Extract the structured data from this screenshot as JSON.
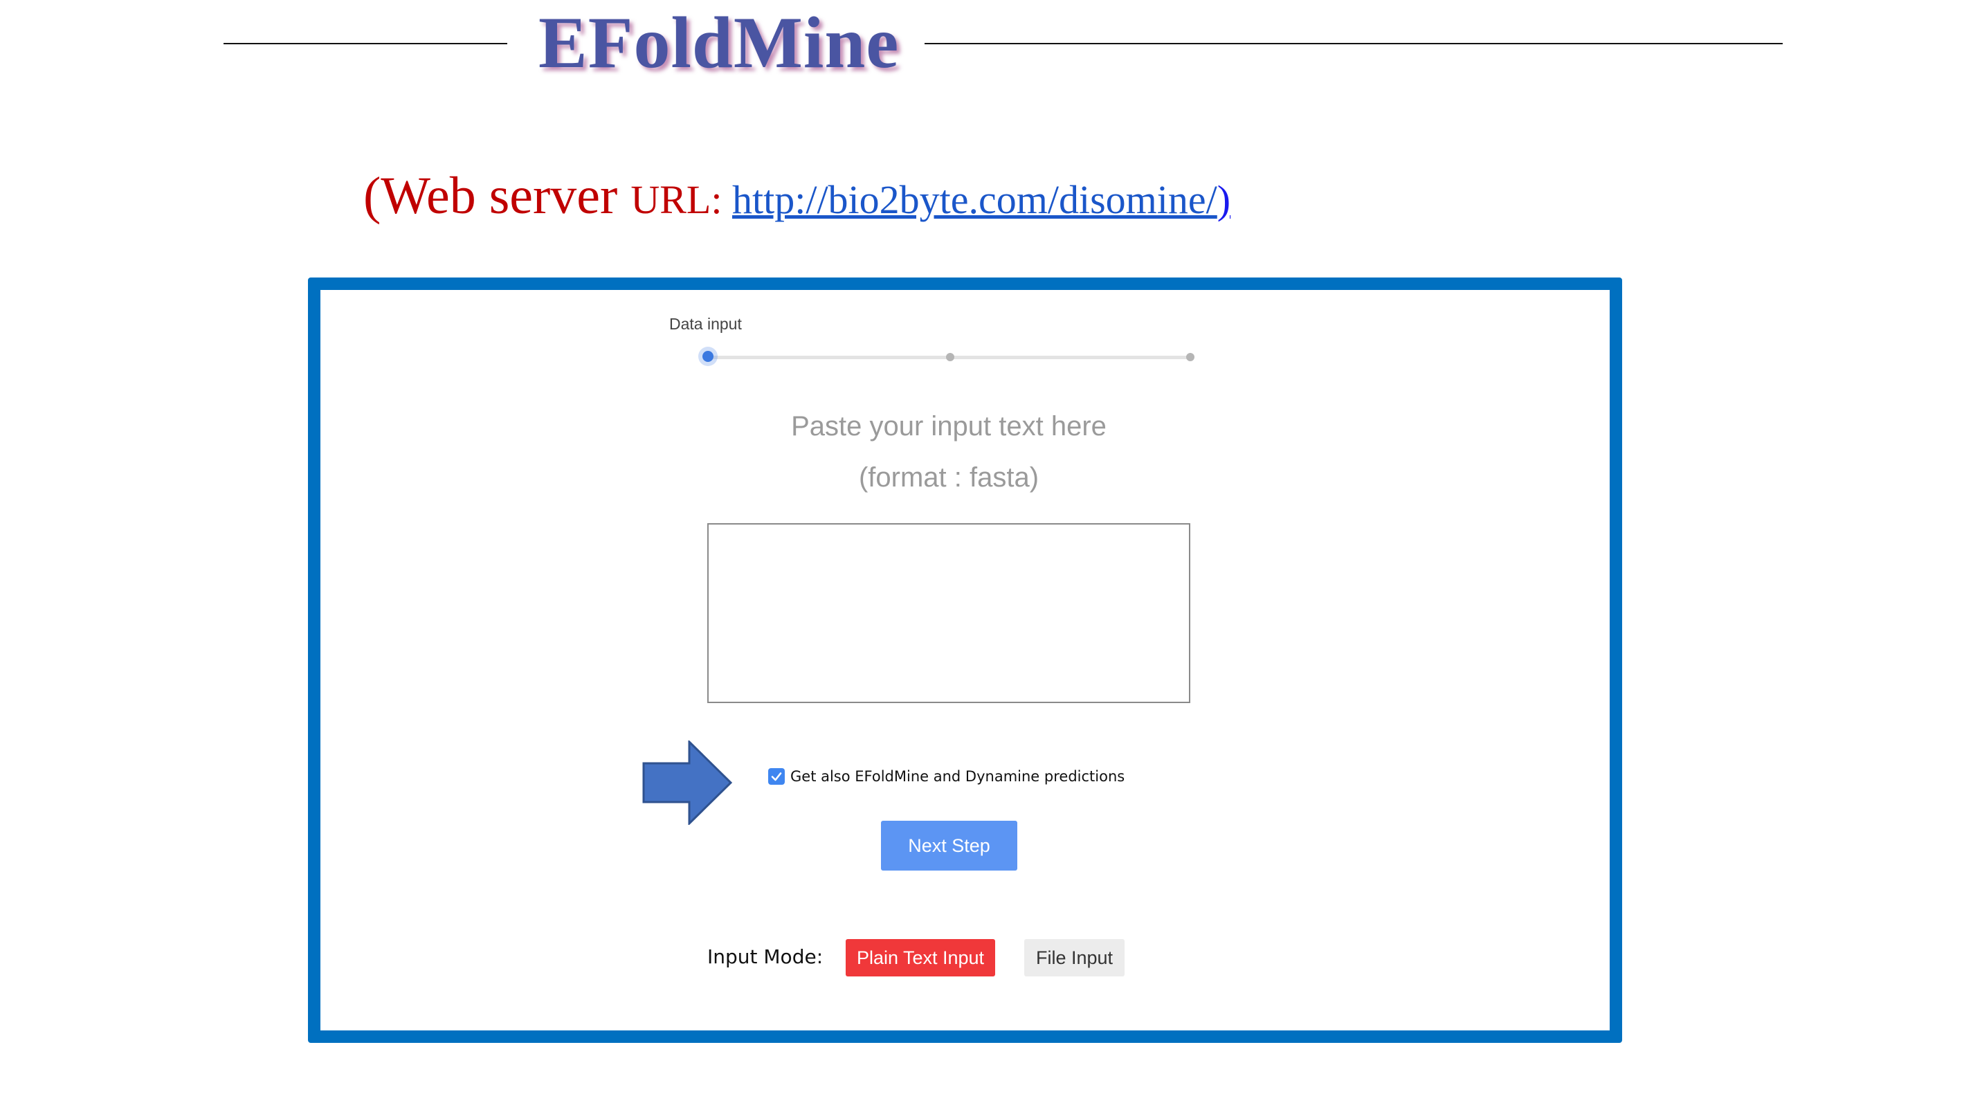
{
  "header": {
    "title": "EFoldMine"
  },
  "server_line": {
    "prefix_big": "(Web server ",
    "prefix_small": "URL: ",
    "link_text": "http://bio2byte.com/disomine/",
    "suffix": ")"
  },
  "form": {
    "stepper": {
      "current_label": "Data input",
      "total_steps": 3,
      "active_step": 1
    },
    "paste_heading": "Paste your input text here",
    "paste_format": "(format : fasta)",
    "sequence_value": "",
    "checkbox": {
      "label": "Get also EFoldMine and Dynamine predictions",
      "checked": true
    },
    "next_button": "Next Step",
    "input_mode": {
      "label": "Input Mode:",
      "options": [
        "Plain Text Input",
        "File Input"
      ],
      "selected": "Plain Text Input"
    }
  },
  "colors": {
    "frame_border": "#0070c0",
    "title": "#4a55a2",
    "server_text": "#c00000",
    "link": "#1a56c9",
    "next_button": "#5c95f3",
    "mode_selected": "#f0383a",
    "mode_unselected": "#ececec",
    "arrow_fill": "#4472c4"
  },
  "icons": {
    "pointer_arrow": "right-block-arrow-icon",
    "checkbox": "checkmark-icon"
  }
}
